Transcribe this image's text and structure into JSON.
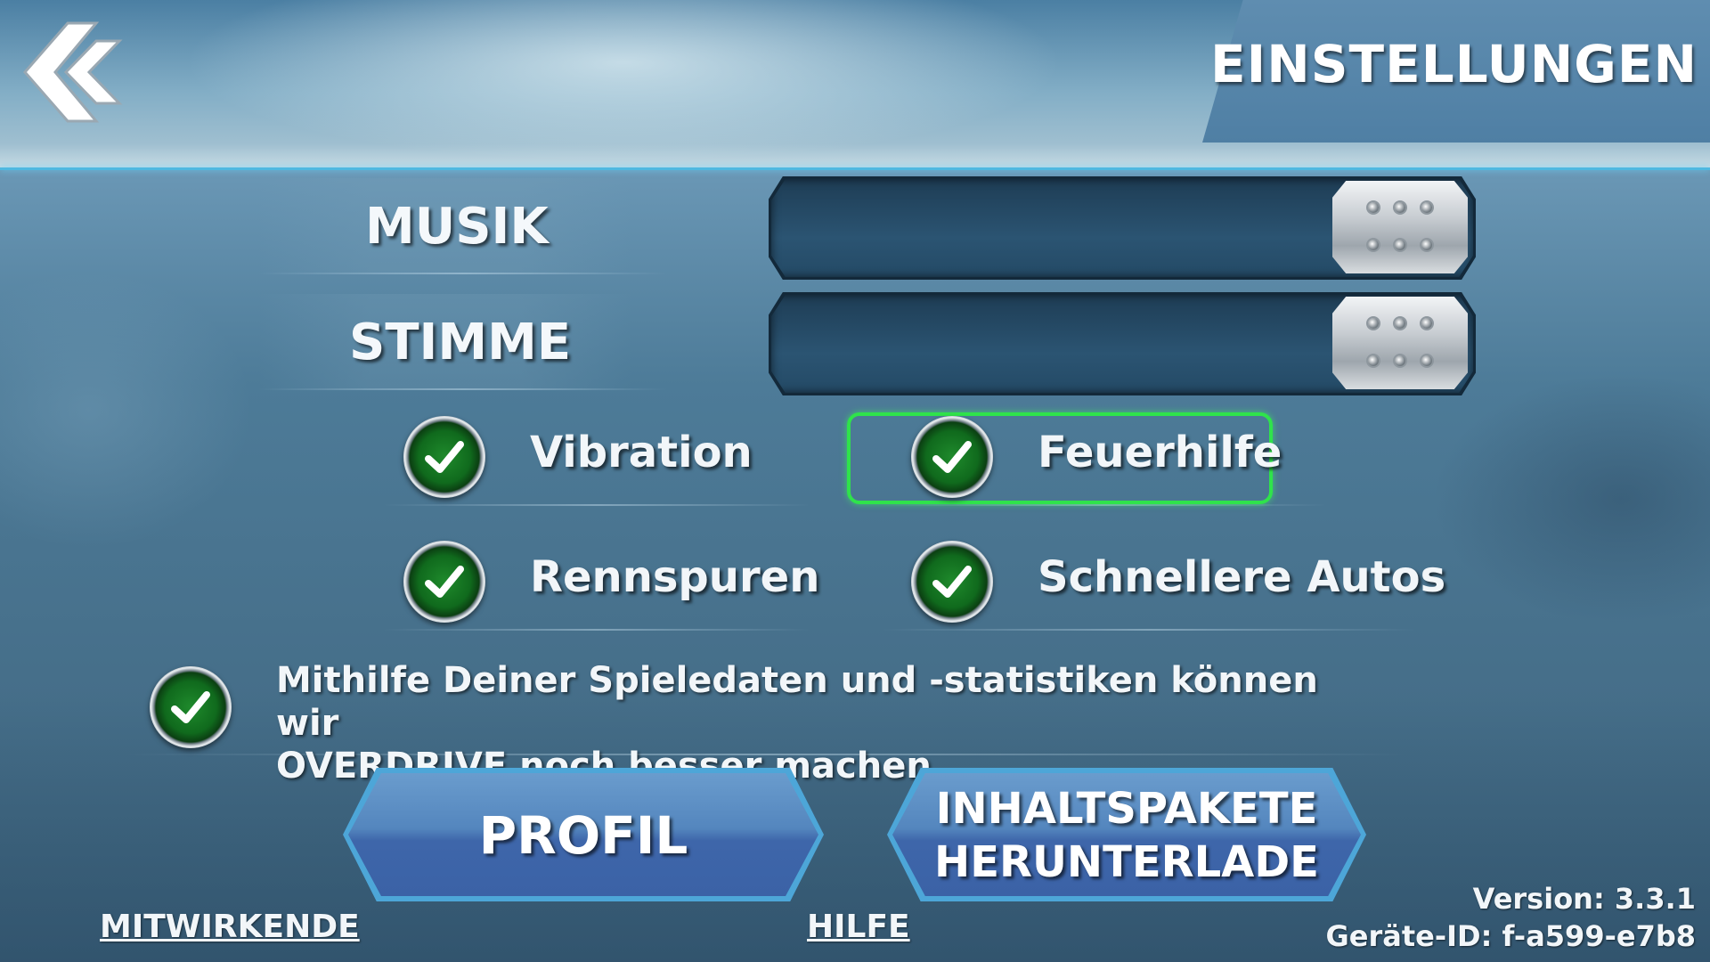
{
  "header": {
    "title": "EINSTELLUNGEN",
    "back_icon": "double-chevron-left-icon"
  },
  "sliders": [
    {
      "label": "MUSIK",
      "level": 1.0
    },
    {
      "label": "STIMME",
      "level": 1.0
    }
  ],
  "options": [
    {
      "label": "Vibration",
      "checked": true
    },
    {
      "label": "Feuerhilfe",
      "checked": true,
      "focused": true
    },
    {
      "label": "Rennspuren",
      "checked": true
    },
    {
      "label": "Schnellere Autos",
      "checked": true
    }
  ],
  "consent": {
    "checked": true,
    "line1": "Mithilfe Deiner Spieledaten und -statistiken können wir",
    "line2": "OVERDRIVE noch besser machen."
  },
  "buttons": {
    "profile": "PROFIL",
    "content_line1": "INHALTSPAKETE",
    "content_line2": "HERUNTERLADE"
  },
  "footer": {
    "credits": "MITWIRKENDE",
    "help": "HILFE",
    "version": "Version: 3.3.1",
    "device_id": "Geräte-ID: f-a599-e7b8"
  },
  "colors": {
    "accent_line": "#4fb8e0",
    "focus": "#2fe34b",
    "check_green": "#1f8a2c",
    "button_blue": "#4da6d8"
  }
}
